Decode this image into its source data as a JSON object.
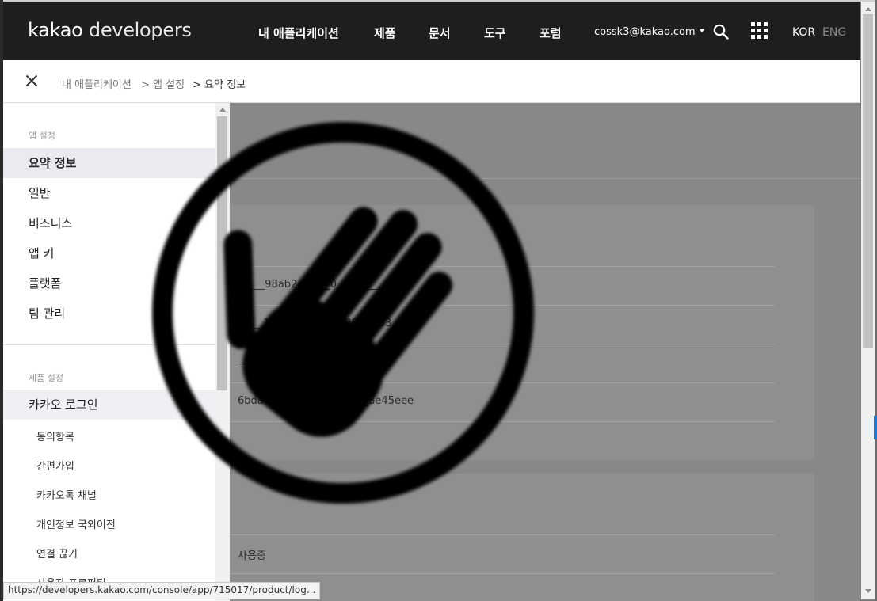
{
  "logo": {
    "brand": "kakao",
    "product": "developers"
  },
  "nav": {
    "items": [
      "내 애플리케이션",
      "제품",
      "문서",
      "도구",
      "포럼"
    ],
    "account": "cossk3@kakao.com",
    "lang_kor": "KOR",
    "lang_eng": "ENG"
  },
  "breadcrumb": [
    "내 애플리케이션",
    "> 앱 설정",
    "> 요약 정보"
  ],
  "sidebar": {
    "section_app": "앱 설정",
    "app_items": [
      "요약 정보",
      "일반",
      "비즈니스",
      "앱 키",
      "플랫폼",
      "팀 관리"
    ],
    "section_product": "제품 설정",
    "product_main": "카카오 로그인",
    "product_subs": [
      "동의항목",
      "간편가입",
      "카카오톡 채널",
      "개인정보 국외이전",
      "연결 끊기",
      "사용자 프로퍼티"
    ]
  },
  "main": {
    "keys": [
      "9____98ab2c5____0____e____c",
      "_____193____________89____53_",
      "______________________298a",
      "6bda7c__________________8e45eee"
    ],
    "status": "사용중"
  },
  "status_bar": {
    "url": "https://developers.kakao.com/console/app/715017/product/log..."
  },
  "colors": {
    "topbar": "#1e1e1e",
    "active_item_bg": "#e9ebf1",
    "dim_overlay": "#888888"
  },
  "icons": {
    "search": "search-icon",
    "apps": "grid-icon",
    "close": "close-icon",
    "blocked": "hand-stop-icon"
  }
}
